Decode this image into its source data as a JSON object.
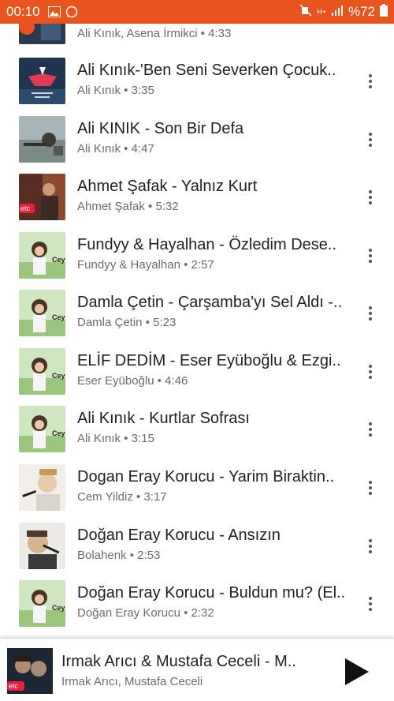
{
  "status_bar": {
    "time": "00:10",
    "battery_percent": "%72",
    "network": "H+",
    "color": "#e8541e"
  },
  "songs": [
    {
      "title": "",
      "subtitle": "Ali Kınık, Asena İrmikci • 4:33"
    },
    {
      "title": "Ali Kınık-'Ben Seni Severken Çocuk..",
      "subtitle": "Ali Kınık • 3:35"
    },
    {
      "title": "Ali KINIK - Son Bir Defa",
      "subtitle": "Ali Kınık • 4:47"
    },
    {
      "title": "Ahmet Şafak - Yalnız Kurt",
      "subtitle": "Ahmet Şafak • 5:32"
    },
    {
      "title": "Fundyy & Hayalhan - Özledim Dese..",
      "subtitle": "Fundyy & Hayalhan • 2:57"
    },
    {
      "title": "Damla Çetin - Çarşamba'yı Sel Aldı -..",
      "subtitle": "Damla Çetin • 5:23"
    },
    {
      "title": "ELİF DEDİM - Eser Eyüboğlu & Ezgi..",
      "subtitle": "Eser Eyüboğlu • 4:46"
    },
    {
      "title": "Ali Kınık - Kurtlar Sofrası",
      "subtitle": "Ali Kınık • 3:15"
    },
    {
      "title": "Dogan Eray Korucu - Yarim Biraktin..",
      "subtitle": "Cem Yildiz • 3:17"
    },
    {
      "title": "Doğan Eray Korucu - Ansızın",
      "subtitle": "Bolahenk • 2:53"
    },
    {
      "title": "Doğan Eray Korucu - Buldun mu? (El..",
      "subtitle": "Doğan Eray Korucu • 2:32"
    }
  ],
  "thumb_labels": {
    "ceyl": "Ceyl",
    "etc": "etc"
  },
  "now_playing": {
    "title": "Irmak Arıcı & Mustafa Ceceli - M..",
    "subtitle": "Irmak Arıcı, Mustafa Ceceli",
    "thumb_label": "etc"
  },
  "icons": {
    "more": "more-vert-icon",
    "play": "play-icon"
  }
}
